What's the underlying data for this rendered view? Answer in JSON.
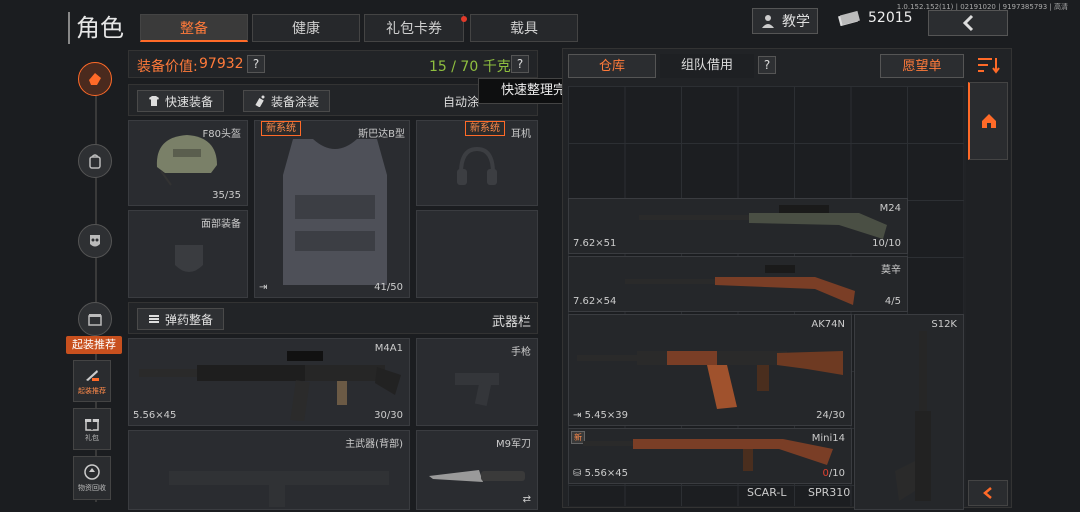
{
  "header": {
    "title": "角色",
    "tabs": [
      "整备",
      "健康",
      "礼包卡券",
      "载具"
    ],
    "tutorial_label": "教学",
    "currency": "52015",
    "version": "1.0.152.152(11) | 02191020 | 9197385793 | 高清"
  },
  "sidebar": {
    "recommend_badge": "起装推荐",
    "recommend_label": "起装推荐",
    "gift_label": "礼包",
    "recycle_label": "物资回收"
  },
  "equipment": {
    "value_label": "装备价值:",
    "value": "97932",
    "weight": "15 / 70 千克",
    "quick_equip": "快速装备",
    "paint": "装备涂装",
    "auto_paint": "自动涂",
    "tooltip": "快速整理完成",
    "slots": {
      "helmet": {
        "name": "F80头盔",
        "count": "35/35"
      },
      "armor": {
        "name": "斯巴达B型",
        "count": "41/50",
        "badge": "新系统"
      },
      "headset": {
        "name": "耳机",
        "badge": "新系统"
      },
      "face": {
        "name": "面部装备"
      }
    },
    "ammo_btn": "弹药整备",
    "weapon_bar": "武器栏",
    "primary": {
      "name": "M4A1",
      "caliber": "5.56×45",
      "count": "30/30"
    },
    "pistol": {
      "name": "手枪"
    },
    "backup": {
      "name": "主武器(背部)"
    },
    "knife": {
      "name": "M9军刀"
    }
  },
  "warehouse": {
    "tab_storage": "仓库",
    "tab_team": "组队借用",
    "wishlist": "愿望单",
    "items": [
      {
        "name": "M24",
        "caliber": "7.62×51",
        "count": "10/10"
      },
      {
        "name": "莫辛",
        "caliber": "7.62×54",
        "count": "4/5"
      },
      {
        "name": "AK74N",
        "caliber": "5.45×39",
        "count": "24/30"
      },
      {
        "name": "S12K"
      },
      {
        "name": "Mini14",
        "caliber": "5.56×45",
        "count_a": "0",
        "count_b": "/10",
        "badge": "新"
      },
      {
        "name": "SCAR-L"
      },
      {
        "name": "SPR310"
      }
    ]
  },
  "colors": {
    "accent": "#ff6a28",
    "green": "#8fbf3f"
  }
}
